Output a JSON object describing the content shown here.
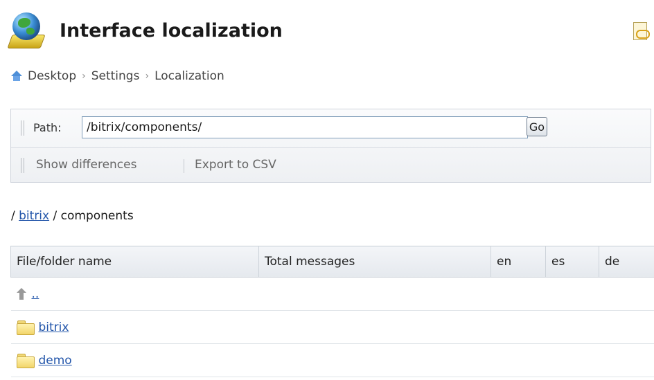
{
  "header": {
    "title": "Interface localization",
    "logo_icon": "globe-book-icon",
    "link_icon": "link-icon"
  },
  "breadcrumb": {
    "home_icon": "home-icon",
    "items": [
      "Desktop",
      "Settings",
      "Localization"
    ],
    "separator": "›"
  },
  "filter": {
    "path_label": "Path:",
    "path_value": "/bitrix/components/",
    "go_label": "Go",
    "toolbar": {
      "show_differences": "Show differences",
      "export_csv": "Export to CSV"
    }
  },
  "path_crumbs": {
    "leading": "/",
    "link": "bitrix",
    "separator": "/",
    "current": "components"
  },
  "table": {
    "columns": [
      "File/folder name",
      "Total messages",
      "en",
      "es",
      "de"
    ],
    "rows": [
      {
        "icon": "up-arrow-icon",
        "name": ".."
      },
      {
        "icon": "folder-icon",
        "name": "bitrix"
      },
      {
        "icon": "folder-icon",
        "name": "demo"
      }
    ]
  },
  "colors": {
    "link": "#2255aa",
    "header_bg": "#e5e9ee",
    "border": "#cdd3da"
  }
}
